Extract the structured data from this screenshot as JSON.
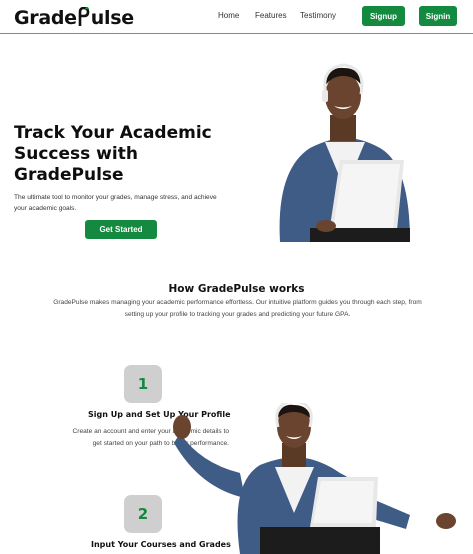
{
  "brand": {
    "name_left": "Grade",
    "name_right": "ulse",
    "accent": "#138a3f"
  },
  "nav": {
    "links": [
      "Home",
      "Features",
      "Testimony"
    ],
    "signup_label": "Signup",
    "signin_label": "Signin"
  },
  "hero": {
    "title": "Track Your Academic Success with GradePulse",
    "subtitle": "The ultimate tool to monitor your grades, manage stress, and achieve your academic goals.",
    "cta_label": "Get Started"
  },
  "how": {
    "title": "How GradePulse works",
    "body": "GradePulse makes managing your academic performance effortless. Our intuitive platform guides you through each step, from setting up your profile to tracking your grades and predicting your future GPA."
  },
  "steps": [
    {
      "number": "1",
      "title": "Sign Up and Set Up Your Profile",
      "description": "Create an account and enter your academic details to get started on your path to better performance."
    },
    {
      "number": "2",
      "title": "Input Your Courses and Grades",
      "description": ""
    }
  ]
}
